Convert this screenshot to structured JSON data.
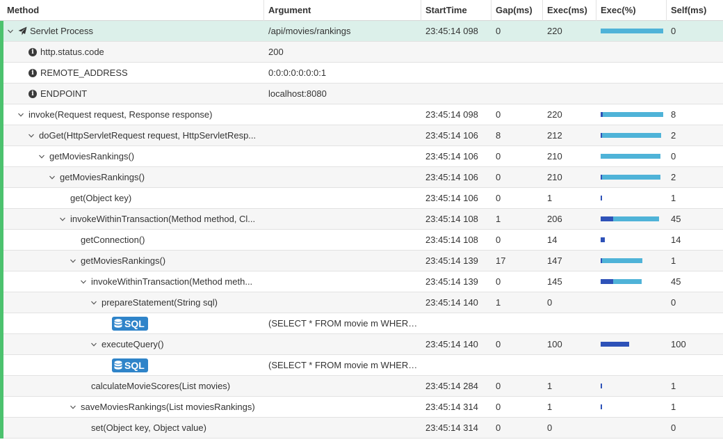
{
  "columns": {
    "method": "Method",
    "argument": "Argument",
    "start": "StartTime",
    "gap": "Gap(ms)",
    "exec": "Exec(ms)",
    "pct": "Exec(%)",
    "self": "Self(ms)"
  },
  "rows": [
    {
      "depth": 0,
      "caret": true,
      "icon": "plane",
      "method": "Servlet Process",
      "argument": "/api/movies/rankings",
      "start": "23:45:14 098",
      "gap": "0",
      "exec": "220",
      "self": "0",
      "pct": 1.0,
      "selfPct": 0.0
    },
    {
      "depth": 1,
      "caret": false,
      "icon": "info",
      "method": "http.status.code",
      "argument": "200",
      "start": "",
      "gap": "",
      "exec": "",
      "self": "",
      "pct": null,
      "selfPct": null
    },
    {
      "depth": 1,
      "caret": false,
      "icon": "info",
      "method": "REMOTE_ADDRESS",
      "argument": "0:0:0:0:0:0:0:1",
      "start": "",
      "gap": "",
      "exec": "",
      "self": "",
      "pct": null,
      "selfPct": null
    },
    {
      "depth": 1,
      "caret": false,
      "icon": "info",
      "method": "ENDPOINT",
      "argument": "localhost:8080",
      "start": "",
      "gap": "",
      "exec": "",
      "self": "",
      "pct": null,
      "selfPct": null
    },
    {
      "depth": 1,
      "caret": true,
      "icon": null,
      "method": "invoke(Request request, Response response)",
      "argument": "",
      "start": "23:45:14 098",
      "gap": "0",
      "exec": "220",
      "self": "8",
      "pct": 1.0,
      "selfPct": 0.036
    },
    {
      "depth": 2,
      "caret": true,
      "icon": null,
      "method": "doGet(HttpServletRequest request, HttpServletResp...",
      "argument": "",
      "start": "23:45:14 106",
      "gap": "8",
      "exec": "212",
      "self": "2",
      "pct": 0.964,
      "selfPct": 0.009
    },
    {
      "depth": 3,
      "caret": true,
      "icon": null,
      "method": "getMoviesRankings()",
      "argument": "",
      "start": "23:45:14 106",
      "gap": "0",
      "exec": "210",
      "self": "0",
      "pct": 0.955,
      "selfPct": 0.0
    },
    {
      "depth": 4,
      "caret": true,
      "icon": null,
      "method": "getMoviesRankings()",
      "argument": "",
      "start": "23:45:14 106",
      "gap": "0",
      "exec": "210",
      "self": "2",
      "pct": 0.955,
      "selfPct": 0.009
    },
    {
      "depth": 5,
      "caret": false,
      "icon": null,
      "method": "get(Object key)",
      "argument": "",
      "start": "23:45:14 106",
      "gap": "0",
      "exec": "1",
      "self": "1",
      "pct": 0.005,
      "selfPct": 0.005
    },
    {
      "depth": 5,
      "caret": true,
      "icon": null,
      "method": "invokeWithinTransaction(Method method, Cl...",
      "argument": "",
      "start": "23:45:14 108",
      "gap": "1",
      "exec": "206",
      "self": "45",
      "pct": 0.936,
      "selfPct": 0.205
    },
    {
      "depth": 6,
      "caret": false,
      "icon": null,
      "method": "getConnection()",
      "argument": "",
      "start": "23:45:14 108",
      "gap": "0",
      "exec": "14",
      "self": "14",
      "pct": 0.064,
      "selfPct": 0.064
    },
    {
      "depth": 6,
      "caret": true,
      "icon": null,
      "method": "getMoviesRankings()",
      "argument": "",
      "start": "23:45:14 139",
      "gap": "17",
      "exec": "147",
      "self": "1",
      "pct": 0.668,
      "selfPct": 0.005
    },
    {
      "depth": 7,
      "caret": true,
      "icon": null,
      "method": "invokeWithinTransaction(Method meth...",
      "argument": "",
      "start": "23:45:14 139",
      "gap": "0",
      "exec": "145",
      "self": "45",
      "pct": 0.659,
      "selfPct": 0.205
    },
    {
      "depth": 8,
      "caret": true,
      "icon": null,
      "method": "prepareStatement(String sql)",
      "argument": "",
      "start": "23:45:14 140",
      "gap": "1",
      "exec": "0",
      "self": "0",
      "pct": null,
      "selfPct": null
    },
    {
      "depth": 9,
      "caret": false,
      "icon": "sql",
      "method": "SQL",
      "argument": "(SELECT * FROM movie m WHERE m.l...",
      "start": "",
      "gap": "",
      "exec": "",
      "self": "",
      "pct": null,
      "selfPct": null
    },
    {
      "depth": 8,
      "caret": true,
      "icon": null,
      "method": "executeQuery()",
      "argument": "",
      "start": "23:45:14 140",
      "gap": "0",
      "exec": "100",
      "self": "100",
      "pct": 0.455,
      "selfPct": 0.455
    },
    {
      "depth": 9,
      "caret": false,
      "icon": "sql",
      "method": "SQL",
      "argument": "(SELECT * FROM movie m WHERE m.l...",
      "start": "",
      "gap": "",
      "exec": "",
      "self": "",
      "pct": null,
      "selfPct": null
    },
    {
      "depth": 7,
      "caret": false,
      "icon": null,
      "method": "calculateMovieScores(List movies)",
      "argument": "",
      "start": "23:45:14 284",
      "gap": "0",
      "exec": "1",
      "self": "1",
      "pct": 0.005,
      "selfPct": 0.005
    },
    {
      "depth": 6,
      "caret": true,
      "icon": null,
      "method": "saveMoviesRankings(List moviesRankings)",
      "argument": "",
      "start": "23:45:14 314",
      "gap": "0",
      "exec": "1",
      "self": "1",
      "pct": 0.005,
      "selfPct": 0.005
    },
    {
      "depth": 7,
      "caret": false,
      "icon": null,
      "method": "set(Object key, Object value)",
      "argument": "",
      "start": "23:45:14 314",
      "gap": "0",
      "exec": "0",
      "self": "0",
      "pct": null,
      "selfPct": null
    }
  ],
  "colors": {
    "exec_bar": "#4fb3d8",
    "self_bar": "#2e52b8",
    "status_stripe": "#4cc26e",
    "selected_row": "#dcf0ea",
    "sql_badge": "#2f84c9"
  }
}
